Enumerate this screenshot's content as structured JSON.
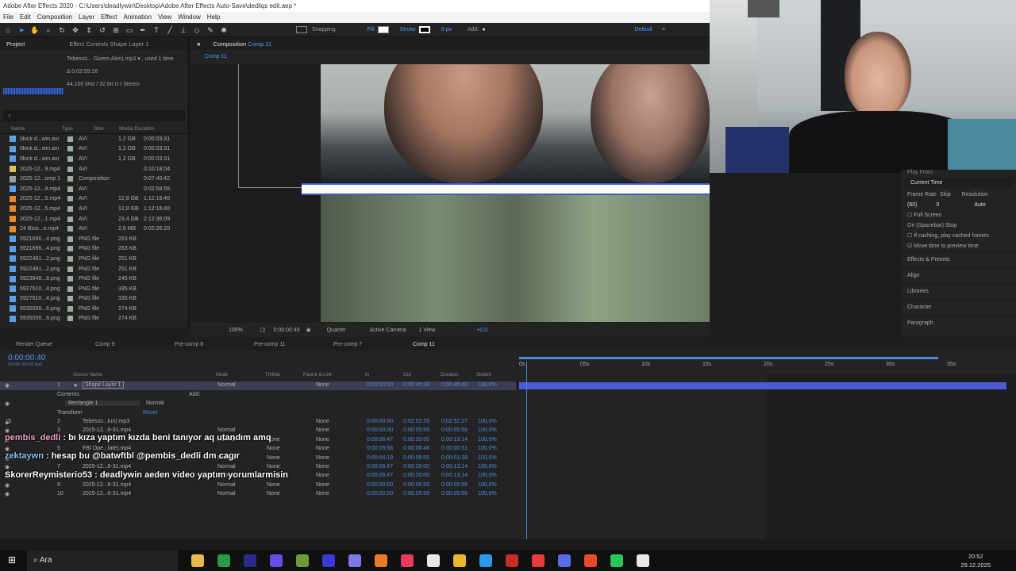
{
  "window": {
    "title": "Adobe After Effects 2020 - C:\\Users\\deadlywin\\Desktop\\Adobe After Effects Auto-Save\\dedliqs edit.aep *",
    "menu": [
      "File",
      "Edit",
      "Composition",
      "Layer",
      "Effect",
      "Animation",
      "View",
      "Window",
      "Help"
    ]
  },
  "toolbar": {
    "snapping": "Snapping",
    "fill": "Fill",
    "stroke": "Stroke",
    "stroke_px": "9 px",
    "add": "Add:",
    "workspace": "Default",
    "fill_color": "#ffffff",
    "stroke_color": "#ffffff"
  },
  "project": {
    "tab_project": "Project",
    "tab_effects": "Effect Controls Shape Layer 1",
    "item_name": "Tebessü... Gizem Akin).mp3 ▾ , used 1 time",
    "item_duration": "Δ 0:02:55:16",
    "item_audio": "44.100 kHz / 32 bit U / Stereo",
    "search_icon": "⌕",
    "columns": [
      "Name",
      "Type",
      "Size",
      "Media Duration"
    ],
    "items": [
      {
        "name": "0kick d...win.avi",
        "type": "AVI",
        "size": "1,2 GB",
        "dur": "0:00:03:31",
        "icon": "#5aa0e8"
      },
      {
        "name": "0kick d...win.avi",
        "type": "AVI",
        "size": "1,2 GB",
        "dur": "0:00:03:31",
        "icon": "#5aa0e8"
      },
      {
        "name": "0kick d...win.avi",
        "type": "AVI",
        "size": "1,2 GB",
        "dur": "0:00:03:31",
        "icon": "#5aa0e8"
      },
      {
        "name": "2025-12...9.mp4",
        "type": "AVI",
        "size": "",
        "dur": "0:10:18:04",
        "icon": "#d8c25a"
      },
      {
        "name": "2025-12...omp 1",
        "type": "Composition",
        "size": "",
        "dur": "0:07:40:42",
        "icon": "#9aa0a8"
      },
      {
        "name": "2025-12...9.mp4",
        "type": "AVI",
        "size": "",
        "dur": "0:02:58:55",
        "icon": "#5aa0e8"
      },
      {
        "name": "2025-12...5.mp4",
        "type": "AVI",
        "size": "12,8 GB",
        "dur": "1:12:16:40",
        "icon": "#e88a2a"
      },
      {
        "name": "2025-12...5.mp4",
        "type": "AVI",
        "size": "12,8 GB",
        "dur": "1:12:16:40",
        "icon": "#e88a2a"
      },
      {
        "name": "2025-12...1.mp4",
        "type": "AVI",
        "size": "23,4 GB",
        "dur": "2:12:36:09",
        "icon": "#e88a2a"
      },
      {
        "name": "24 Bloo...e.mp4",
        "type": "AVI",
        "size": "2,6 MB",
        "dur": "0:02:26:20",
        "icon": "#e88a2a"
      },
      {
        "name": "5921696...4.png",
        "type": "PNG file",
        "size": "263 KB",
        "dur": "",
        "icon": "#5aa0e8"
      },
      {
        "name": "5921696...4.png",
        "type": "PNG file",
        "size": "263 KB",
        "dur": "",
        "icon": "#5aa0e8"
      },
      {
        "name": "5922491...2.png",
        "type": "PNG file",
        "size": "251 KB",
        "dur": "",
        "icon": "#5aa0e8"
      },
      {
        "name": "5922491...2.png",
        "type": "PNG file",
        "size": "251 KB",
        "dur": "",
        "icon": "#5aa0e8"
      },
      {
        "name": "5923648...8.png",
        "type": "PNG file",
        "size": "245 KB",
        "dur": "",
        "icon": "#5aa0e8"
      },
      {
        "name": "5927610...4.png",
        "type": "PNG file",
        "size": "335 KB",
        "dur": "",
        "icon": "#5aa0e8"
      },
      {
        "name": "5927610...4.png",
        "type": "PNG file",
        "size": "335 KB",
        "dur": "",
        "icon": "#5aa0e8"
      },
      {
        "name": "5935056...6.png",
        "type": "PNG file",
        "size": "274 KB",
        "dur": "",
        "icon": "#5aa0e8"
      },
      {
        "name": "5935056...6.png",
        "type": "PNG file",
        "size": "274 KB",
        "dur": "",
        "icon": "#5aa0e8"
      }
    ]
  },
  "composition": {
    "tab": "Composition",
    "tab_name": "Comp 11",
    "breadcrumb": "Comp 11",
    "zoom": "100%",
    "time": "0:00:00:40",
    "resolution": "Quarter",
    "camera": "Active Camera",
    "view": "1 View",
    "exposure": "+0,0"
  },
  "preview": {
    "play_from": "Play From",
    "current_time": "Current Time",
    "frame_rate_label": "Frame Rate",
    "skip_label": "Skip",
    "resolution_label": "Resolution",
    "frame_rate": "(60)",
    "skip": "0",
    "resolution": "Auto",
    "full_screen": "Full Screen",
    "on_spacebar": "On (Spacebar) Stop",
    "if_caching": "If caching, play cached frames",
    "move_time": "Move time to preview time",
    "panels": [
      "Effects & Presets",
      "Align",
      "Libraries",
      "Character",
      "Paragraph"
    ]
  },
  "timeline": {
    "tabs": [
      "Render Queue",
      "Comp 9",
      "Pre-comp 8",
      "Pre-comp 11",
      "Pre-comp 7",
      "Comp 11"
    ],
    "timecode": "0:00:00:40",
    "timecode_sub": "00040 (60.00 fps)",
    "columns": {
      "source": "Source Name",
      "mode": "Mode",
      "trkmat": "TrkMat",
      "parent": "Parent & Link",
      "in": "In",
      "out": "Out",
      "duration": "Duration",
      "stretch": "Stretch"
    },
    "ruler": [
      "0s",
      "05s",
      "10s",
      "15s",
      "20s",
      "25s",
      "30s",
      "35s"
    ],
    "layer1": {
      "num": "1",
      "name": "Shape Layer 1",
      "mode": "Normal",
      "parent": "None",
      "in": "0:00:00:00",
      "out": "0:00:45:39",
      "dur": "0:00:45:40",
      "stretch": "100,0%"
    },
    "contents": "Contents",
    "add": "Add:",
    "rectangle": "Rectangle 1",
    "rect_mode": "Normal",
    "transform": "Transform",
    "reset": "Reset",
    "layers": [
      {
        "num": "2",
        "name": "Tebessü...kın).mp3",
        "mode": "",
        "trk": "",
        "parent": "None",
        "in": "0:00:00:00",
        "out": "0:02:52:26",
        "dur": "0:02:52:27",
        "stretch": "100,0%"
      },
      {
        "num": "3",
        "name": "2025-12...6-31.mp4",
        "mode": "Normal",
        "trk": "",
        "parent": "None",
        "in": "0:00:00:00",
        "out": "0:00:05:55",
        "dur": "0:00:05:56",
        "stretch": "100,0%"
      },
      {
        "num": "4",
        "name": "",
        "mode": "Normal",
        "trk": "None",
        "parent": "None",
        "in": "0:00:06:47",
        "out": "0:00:20:00",
        "dur": "0:00:13:14",
        "stretch": "100,0%"
      },
      {
        "num": "5",
        "name": "FBI Ope...late).mp4",
        "mode": "",
        "trk": "None",
        "parent": "None",
        "in": "0:00:05:56",
        "out": "0:00:06:46",
        "dur": "0:00:00:51",
        "stretch": "100,0%"
      },
      {
        "num": "6",
        "name": "",
        "mode": "Normal",
        "trk": "None",
        "parent": "None",
        "in": "0:00:04:18",
        "out": "0:00:05:55",
        "dur": "0:00:01:38",
        "stretch": "100,0%"
      },
      {
        "num": "7",
        "name": "2025-12...6-31.mp4",
        "mode": "Normal",
        "trk": "None",
        "parent": "None",
        "in": "0:00:06:47",
        "out": "0:00:20:00",
        "dur": "0:00:13:14",
        "stretch": "100,0%"
      },
      {
        "num": "8",
        "name": "",
        "mode": "Normal",
        "trk": "None",
        "parent": "None",
        "in": "0:00:06:47",
        "out": "0:00:20:00",
        "dur": "0:00:13:14",
        "stretch": "100,0%"
      },
      {
        "num": "9",
        "name": "2025-12...6-31.mp4",
        "mode": "Normal",
        "trk": "None",
        "parent": "None",
        "in": "0:00:00:00",
        "out": "0:00:05:55",
        "dur": "0:00:05:56",
        "stretch": "100,0%"
      },
      {
        "num": "10",
        "name": "2025-12...6-31.mp4",
        "mode": "Normal",
        "trk": "None",
        "parent": "None",
        "in": "0:00:00:00",
        "out": "0:00:05:55",
        "dur": "0:00:05:56",
        "stretch": "100,0%"
      }
    ]
  },
  "chat": [
    {
      "user": "pembis_dedli",
      "text": " : bı kıza yaptım kızda beni tanıyor aq utandım amq"
    },
    {
      "user": "zektaywn",
      "text": " : hesap bu @batwftbl @pembis_dedli dm cagır"
    },
    {
      "user": "SkorerReymisterio53",
      "text": " : deadlywin aeden video yaptım yorumlarmisin"
    }
  ],
  "taskbar": {
    "search": "Ara",
    "time": "20:52",
    "date": "29.12.2025",
    "apps": [
      "#e8b84a",
      "#2a9a4a",
      "#2a2a8a",
      "#6a4ae8",
      "#6a9a3a",
      "#3a3ad8",
      "#7a7ae8",
      "#e87a2a",
      "#e83a5a",
      "#e8e8e8",
      "#e8b82a",
      "#2a9ae8",
      "#c82a2a",
      "#e83a3a",
      "#5a6ae8",
      "#e84a2a",
      "#2ac85a",
      "#e8e8e8"
    ]
  }
}
